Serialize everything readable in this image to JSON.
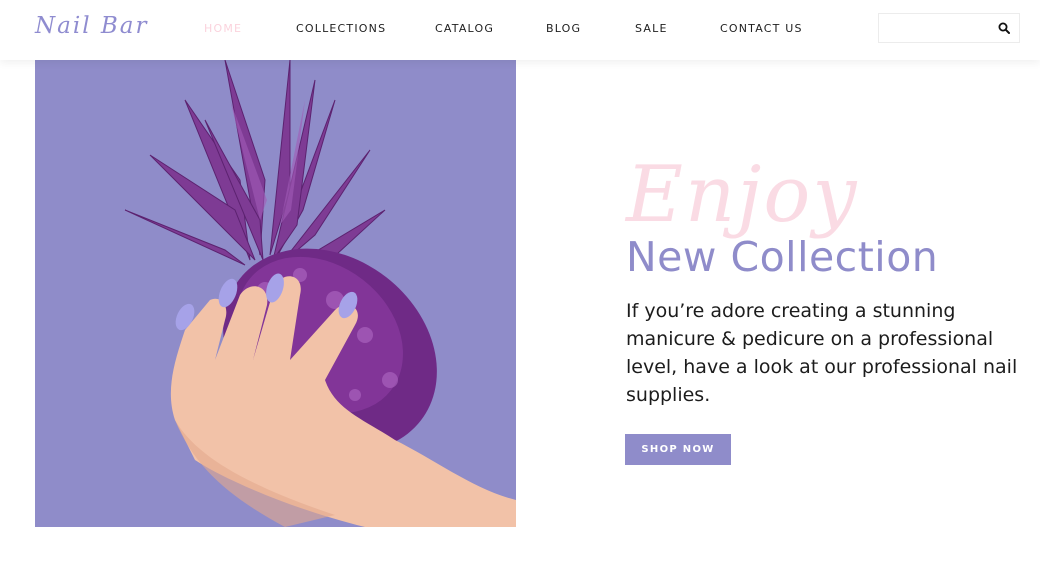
{
  "header": {
    "logo_text": "Nail Bar",
    "nav": [
      {
        "label": "HOME",
        "active": true
      },
      {
        "label": "COLLECTIONS",
        "active": false
      },
      {
        "label": "CATALOG",
        "active": false
      },
      {
        "label": "BLOG",
        "active": false
      },
      {
        "label": "SALE",
        "active": false
      },
      {
        "label": "CONTACT US",
        "active": false
      }
    ],
    "search": {
      "value": "",
      "placeholder": "",
      "icon": "search-icon"
    }
  },
  "hero": {
    "image_icon": "pineapple-hand-photo",
    "script_word": "Enjoy",
    "title": "New Collection",
    "description": "If you’re adore creating a stunning manicure & pedicure on a professional level, have a look at our professional nail supplies.",
    "button_label": "SHOP NOW"
  },
  "colors": {
    "accent": "#8f8cca",
    "active_nav": "#fbd3dd",
    "script_pink": "#fadbe4",
    "image_bg": "#8f8cc9",
    "text": "#1c1c1c"
  }
}
